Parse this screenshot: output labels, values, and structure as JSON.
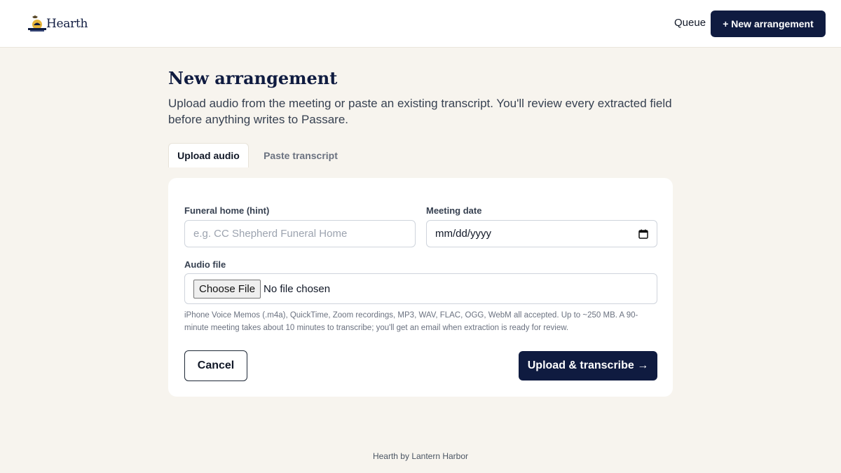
{
  "header": {
    "logo_text": "Hearth",
    "queue_label": "Queue",
    "new_button_label": "+ New arrangement"
  },
  "page": {
    "title": "New arrangement",
    "subtitle": "Upload audio from the meeting or paste an existing transcript. You'll review every extracted field before anything writes to Passare."
  },
  "tabs": [
    {
      "label": "Upload audio",
      "active": true
    },
    {
      "label": "Paste transcript",
      "active": false
    }
  ],
  "form": {
    "funeral_home_label": "Funeral home (hint)",
    "funeral_home_placeholder": "e.g. CC Shepherd Funeral Home",
    "funeral_home_value": "",
    "meeting_date_label": "Meeting date",
    "meeting_date_value": "mm/dd/yyyy",
    "audio_file_label": "Audio file",
    "choose_file_label": "Choose File",
    "file_status": "No file chosen",
    "help_text": "iPhone Voice Memos (.m4a), QuickTime, Zoom recordings, MP3, WAV, FLAC, OGG, WebM all accepted. Up to ~250 MB. A 90-minute meeting takes about 10 minutes to transcribe; you'll get an email when extraction is ready for review.",
    "cancel_label": "Cancel",
    "submit_label": "Upload & transcribe →"
  },
  "footer": {
    "text": "Hearth by Lantern Harbor"
  },
  "colors": {
    "background": "#f7f4ee",
    "primary": "#0f1b40",
    "card": "#ffffff"
  },
  "icons": {
    "logo": "hearth-logo-icon",
    "date": "calendar-icon"
  }
}
